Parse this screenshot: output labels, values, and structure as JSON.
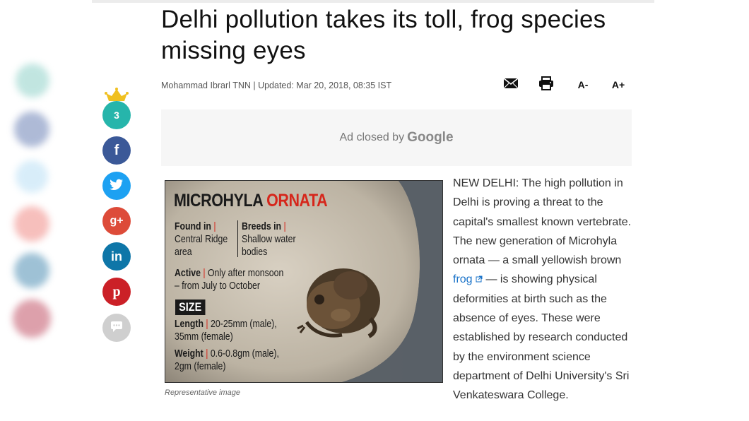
{
  "headline": "Delhi pollution takes its toll, frog species missing eyes",
  "byline": "Mohammad Ibrarl TNN | Updated: Mar 20, 2018, 08:35 IST",
  "tools": {
    "email_icon": "envelope-icon",
    "print_icon": "printer-icon",
    "font_decrease_label": "A-",
    "font_increase_label": "A+"
  },
  "ad": {
    "prefix": "Ad closed by",
    "brand": "Google"
  },
  "social": {
    "share_count": "3",
    "items": [
      {
        "name": "facebook-icon",
        "glyph": "f",
        "color": "#3b5998"
      },
      {
        "name": "twitter-icon",
        "glyph": "t",
        "color": "#1da1f2"
      },
      {
        "name": "google-plus-icon",
        "glyph": "g+",
        "color": "#dd4b39"
      },
      {
        "name": "linkedin-icon",
        "glyph": "in",
        "color": "#0e76a8"
      },
      {
        "name": "pinterest-icon",
        "glyph": "p",
        "color": "#cb2027"
      },
      {
        "name": "comment-icon",
        "glyph": "...",
        "color": "#cfcfcf"
      }
    ]
  },
  "infographic": {
    "title_part1": "MICROHYLA",
    "title_part2": "ORNATA",
    "found_label": "Found in",
    "found_value": "Central Ridge area",
    "breeds_label": "Breeds in",
    "breeds_value": "Shallow water bodies",
    "active_label": "Active",
    "active_value": "Only after monsoon – from July to October",
    "size_label": "SIZE",
    "length_label": "Length",
    "length_value": "20-25mm (male), 35mm (female)",
    "weight_label": "Weight",
    "weight_value": "0.6-0.8gm (male), 2gm (female)"
  },
  "caption": "Representative image",
  "article": {
    "text_before": "NEW DELHI: The high pollution in Delhi is proving a threat to the capital's smallest known vertebrate. The new generation of Microhyla ornata — a small yellowish brown ",
    "link_text": "frog",
    "text_after": " — is showing physical deformities at birth such as the absence of eyes. These were established by research conducted by the environment science department of Delhi University's Sri Venkateswara College."
  },
  "colors": {
    "accent_red": "#d6261b",
    "link_blue": "#1a73c9",
    "share_teal": "#26b5ab"
  }
}
